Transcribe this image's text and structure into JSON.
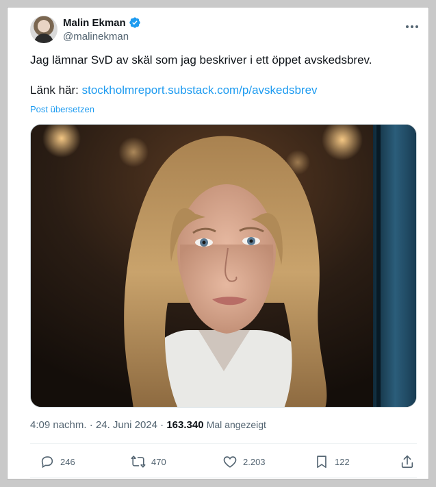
{
  "author": {
    "name": "Malin Ekman",
    "handle": "@malinekman",
    "verified_color": "#1d9bf0"
  },
  "tweet": {
    "text_line1": "Jag lämnar SvD av skäl som jag beskriver i ett öppet avskedsbrev.",
    "text_line2_prefix": "Länk här: ",
    "link_text": "stockholmreport.substack.com/p/avskedsbrev",
    "translate_label": "Post übersetzen"
  },
  "meta": {
    "time": "4:09 nachm.",
    "separator": " · ",
    "date": "24. Juni 2024",
    "views_count": "163.340",
    "views_label": "Mal angezeigt"
  },
  "actions": {
    "replies": "246",
    "reposts": "470",
    "likes": "2.203",
    "bookmarks": "122"
  },
  "icons": {
    "more": "more-horizontal-icon",
    "verified": "verified-badge-icon",
    "reply": "reply-icon",
    "repost": "repost-icon",
    "like": "heart-icon",
    "bookmark": "bookmark-icon",
    "share": "share-icon"
  },
  "colors": {
    "accent": "#1d9bf0",
    "text": "#0f1419",
    "secondary": "#536471"
  }
}
